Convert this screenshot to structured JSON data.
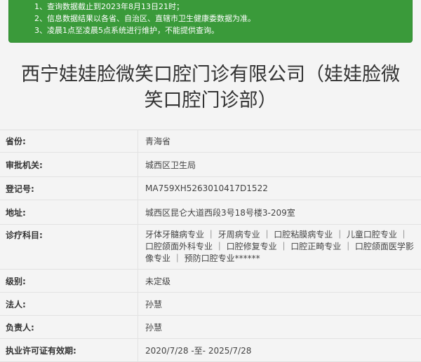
{
  "notice": {
    "lines": [
      "1、查询数据截止到2023年8月13日21时；",
      "2、信息数据结果以各省、自治区、直辖市卫生健康委数据为准。",
      "3、凌晨1点至凌晨5点系统进行维护，不能提供查询。"
    ]
  },
  "title": {
    "line1": "西宁娃娃脸微笑口腔门诊有限公司（娃娃脸微",
    "line2": "笑口腔门诊部）"
  },
  "fields": [
    {
      "label": "省份:",
      "value": "青海省"
    },
    {
      "label": "审批机关:",
      "value": "城西区卫生局"
    },
    {
      "label": "登记号:",
      "value": "MA759XH5263010417D1522"
    },
    {
      "label": "地址:",
      "value": "城西区昆仑大道西段3号18号楼3-209室"
    },
    {
      "label": "诊疗科目:",
      "value": "牙体牙髓病专业 ｜ 牙周病专业 ｜ 口腔粘膜病专业 ｜ 儿童口腔专业 ｜ 口腔颌面外科专业 ｜ 口腔修复专业 ｜ 口腔正畸专业 ｜ 口腔颌面医学影像专业 ｜ 预防口腔专业******"
    },
    {
      "label": "级别:",
      "value": "未定级"
    },
    {
      "label": "法人:",
      "value": "孙慧"
    },
    {
      "label": "负责人:",
      "value": "孙慧"
    },
    {
      "label": "执业许可证有效期:",
      "value": "2020/7/28 -至- 2025/7/28"
    }
  ]
}
